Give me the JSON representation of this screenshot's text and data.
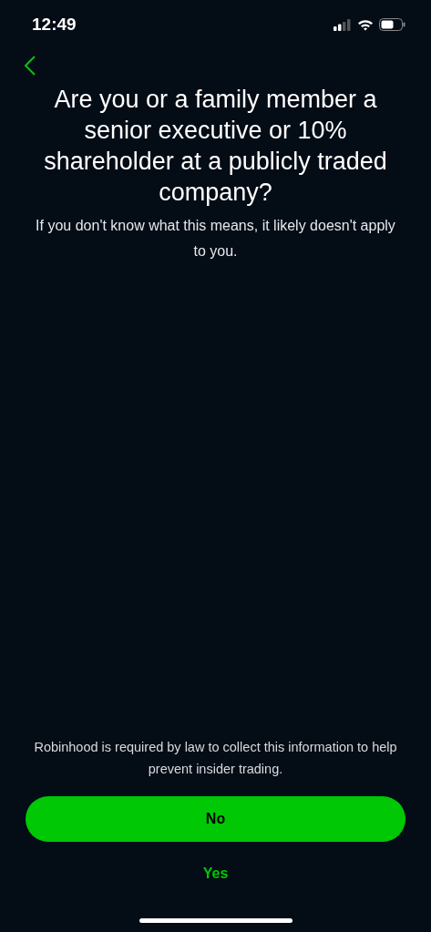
{
  "status_bar": {
    "time": "12:49"
  },
  "title": "Are you or a family member a senior executive or 10% shareholder at a publicly traded company?",
  "subtitle": "If you don't know what this means, it likely doesn't apply to you.",
  "disclaimer": "Robinhood is required by law to collect this information to help prevent insider trading.",
  "buttons": [
    {
      "label": "No",
      "kind": "primary"
    },
    {
      "label": "Yes",
      "kind": "text"
    }
  ]
}
